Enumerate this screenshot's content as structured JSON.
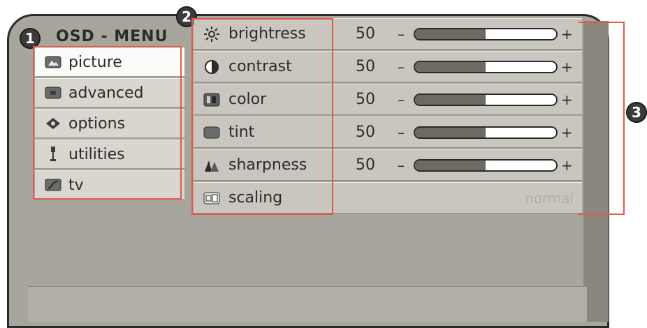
{
  "menu": {
    "title": "OSD - MENU",
    "items": [
      {
        "label": "picture",
        "icon": "picture-icon",
        "active": true
      },
      {
        "label": "advanced",
        "icon": "advanced-icon",
        "active": false
      },
      {
        "label": "options",
        "icon": "options-icon",
        "active": false
      },
      {
        "label": "utilities",
        "icon": "utilities-icon",
        "active": false
      },
      {
        "label": "tv",
        "icon": "tv-icon",
        "active": false
      }
    ]
  },
  "settings": {
    "rows": [
      {
        "label": "brightress",
        "value": "50",
        "level": 0.5,
        "icon": "sun-icon"
      },
      {
        "label": "contrast",
        "value": "50",
        "level": 0.5,
        "icon": "contrast-icon"
      },
      {
        "label": "color",
        "value": "50",
        "level": 0.5,
        "icon": "color-icon"
      },
      {
        "label": "tint",
        "value": "50",
        "level": 0.5,
        "icon": "tint-icon"
      },
      {
        "label": "sharpness",
        "value": "50",
        "level": 0.5,
        "icon": "sharpness-icon"
      }
    ],
    "scaling": {
      "label": "scaling",
      "value": "normal",
      "icon": "scaling-icon"
    },
    "minus_symbol": "–",
    "plus_symbol": "+"
  },
  "callouts": {
    "one": "1",
    "two": "2",
    "three": "3"
  },
  "colors": {
    "highlight": "#e05a4a",
    "frame": "#a8a59d",
    "slider_fill": "#6d6a64"
  }
}
